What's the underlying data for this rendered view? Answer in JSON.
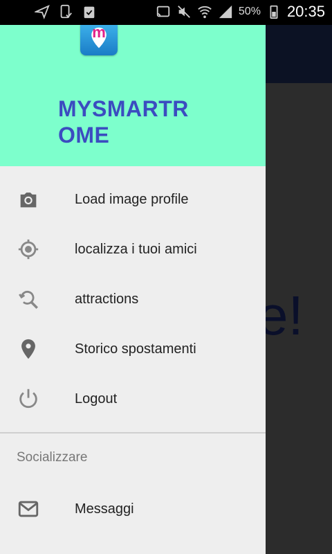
{
  "status_bar": {
    "battery_percent": "50%",
    "time": "20:35"
  },
  "background": {
    "partial_text": "e!"
  },
  "drawer": {
    "app_name": "MYSMARTROME",
    "logo_letter": "m",
    "items": [
      {
        "label": "Load image profile",
        "icon": "camera-icon"
      },
      {
        "label": "localizza i tuoi amici",
        "icon": "gps-fixed-icon"
      },
      {
        "label": "attractions",
        "icon": "search-refresh-icon"
      },
      {
        "label": "Storico spostamenti",
        "icon": "location-pin-icon"
      },
      {
        "label": "Logout",
        "icon": "power-icon"
      }
    ],
    "section_title": "Socializzare",
    "section_items": [
      {
        "label": "Messaggi",
        "icon": "mail-icon"
      }
    ]
  },
  "colors": {
    "header_bg": "#7dffcc",
    "app_name": "#3b4cc0",
    "drawer_bg": "#eeeeee"
  }
}
